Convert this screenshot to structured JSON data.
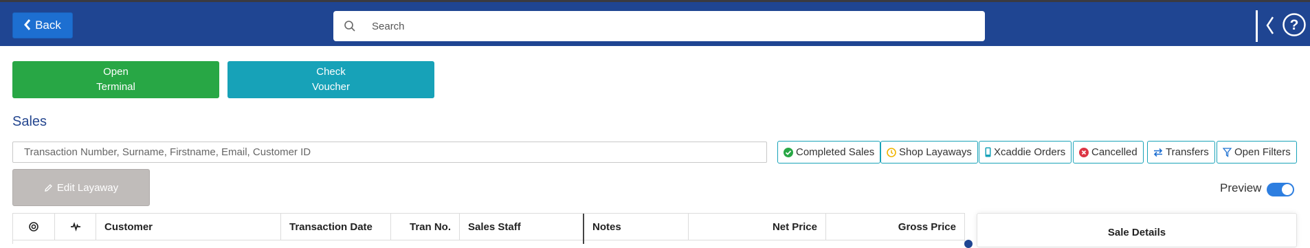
{
  "topbar": {
    "back_label": "Back",
    "search_placeholder": "Search",
    "icons": [
      "search-icon",
      "collapse-icon",
      "help-icon"
    ]
  },
  "actions": {
    "open_terminal": [
      "Open",
      "Terminal"
    ],
    "check_voucher": [
      "Check",
      "Voucher"
    ]
  },
  "sales": {
    "title": "Sales",
    "filter_placeholder": "Transaction Number, Surname, Firstname, Email, Customer ID",
    "filters": {
      "completed": "Completed Sales",
      "layaways": "Shop Layaways",
      "xcaddie": "Xcaddie Orders",
      "cancelled": "Cancelled",
      "transfers": "Transfers",
      "open_filters": "Open Filters"
    },
    "edit_layaway": "Edit Layaway",
    "preview_label": "Preview",
    "preview_on": true
  },
  "table": {
    "columns": [
      "Customer",
      "Transaction Date",
      "Tran No.",
      "Sales Staff",
      "Notes",
      "Net Price",
      "Gross Price"
    ]
  },
  "details": {
    "title": "Sale Details"
  },
  "colors": {
    "topbar": "#1f4592",
    "back_button": "#1d6fd1",
    "green": "#28a745",
    "teal": "#17a2b8",
    "disabled": "#c0bcba",
    "toggle": "#2d7ee0"
  }
}
